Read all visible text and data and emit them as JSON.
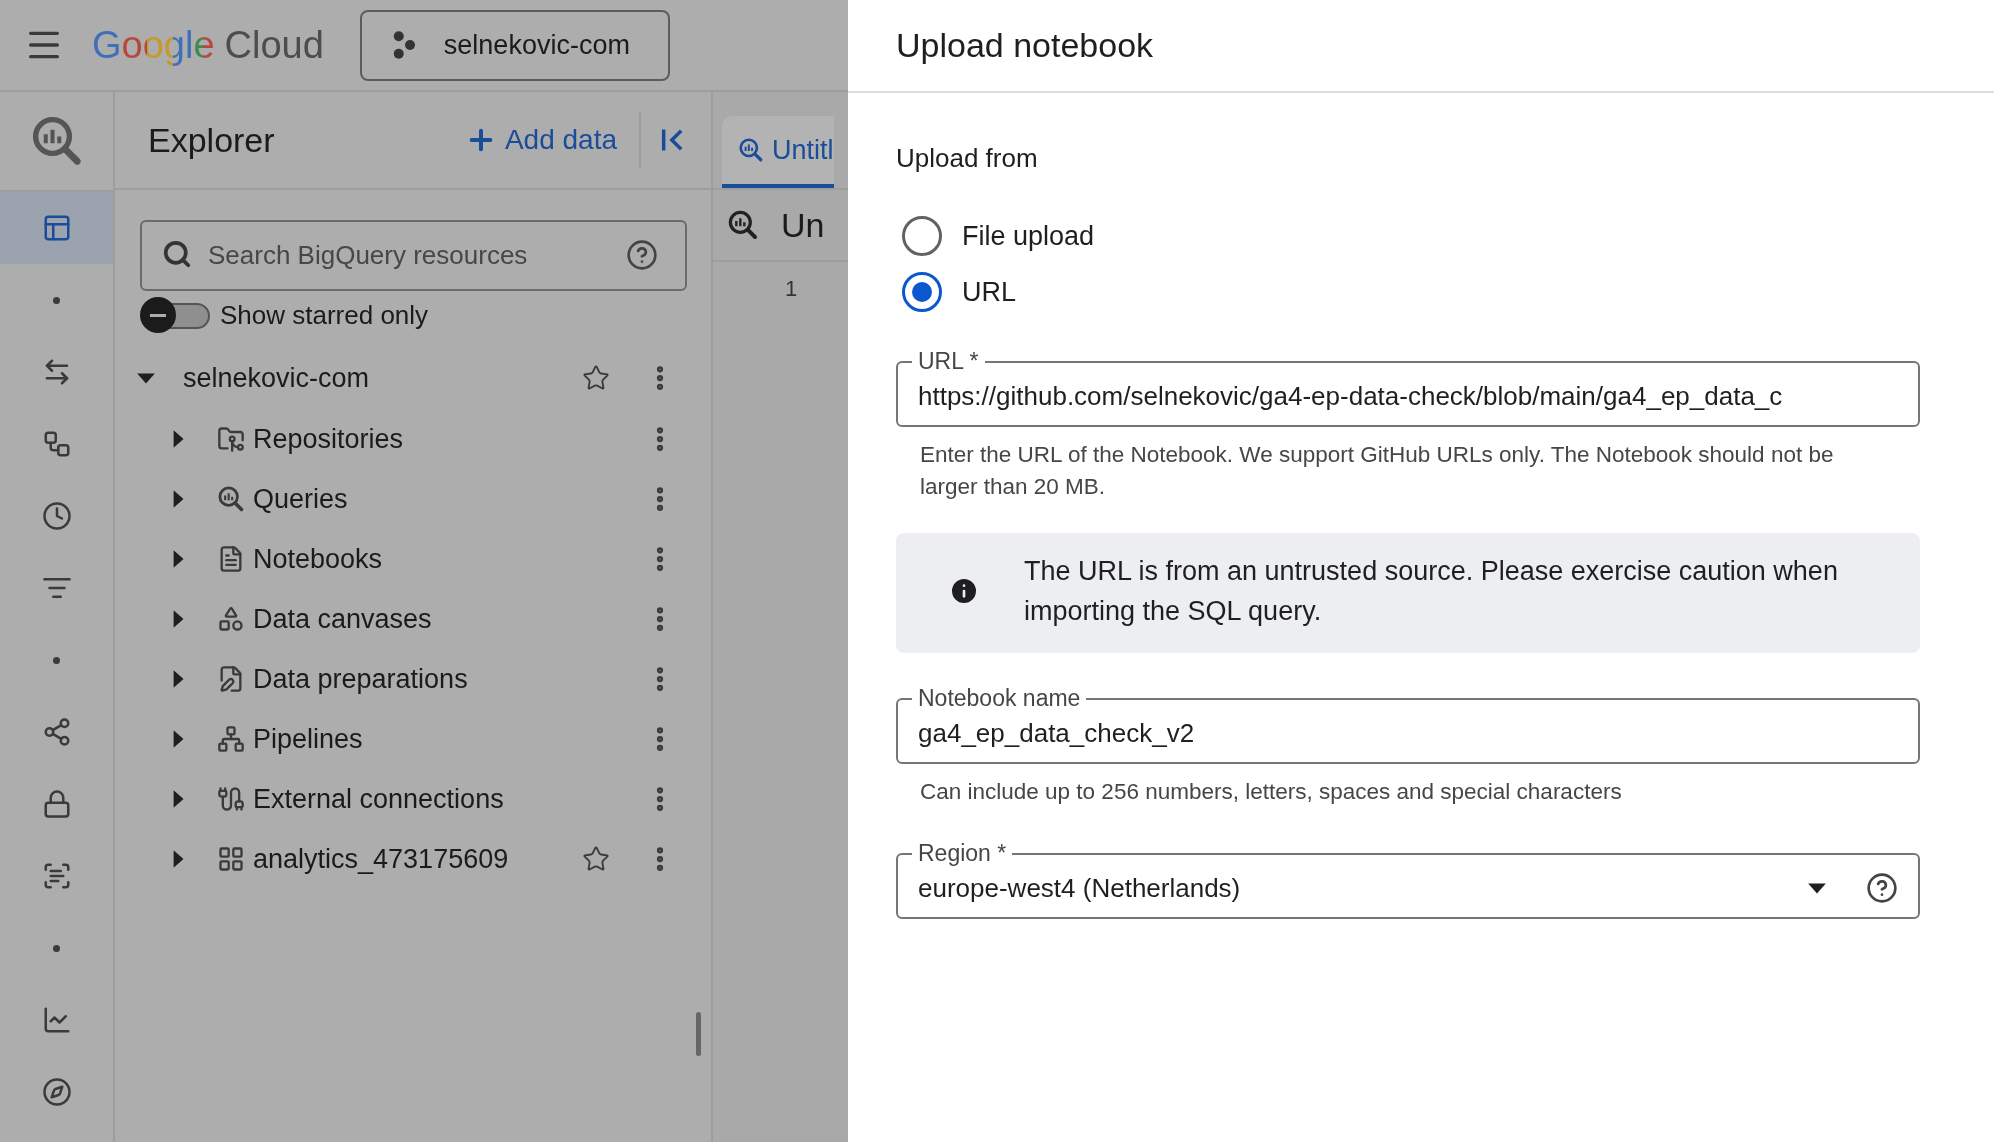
{
  "topbar": {
    "logo_google": "Google",
    "logo_product": "Cloud",
    "project": "selnekovic-com"
  },
  "rail": {
    "items": [
      {
        "kind": "explorer",
        "selected": true
      },
      {
        "kind": "dot",
        "selected": false
      },
      {
        "kind": "transfers",
        "selected": false
      },
      {
        "kind": "pipelines",
        "selected": false
      },
      {
        "kind": "history",
        "selected": false
      },
      {
        "kind": "filter",
        "selected": false
      },
      {
        "kind": "dot",
        "selected": false
      },
      {
        "kind": "sharing",
        "selected": false
      },
      {
        "kind": "lock",
        "selected": false
      },
      {
        "kind": "scan",
        "selected": false
      },
      {
        "kind": "dot",
        "selected": false
      },
      {
        "kind": "chart",
        "selected": false
      },
      {
        "kind": "compass",
        "selected": false
      }
    ]
  },
  "explorer": {
    "title": "Explorer",
    "add_data": "Add data",
    "search": {
      "placeholder": "Search BigQuery resources"
    },
    "starred_toggle": {
      "label": "Show starred only",
      "on": false
    },
    "tree": [
      {
        "label": "selnekovic-com",
        "kind": "project",
        "expanded": true,
        "children": [
          {
            "label": "Repositories",
            "kind": "repositories",
            "expanded": false
          },
          {
            "label": "Queries",
            "kind": "queries",
            "expanded": false
          },
          {
            "label": "Notebooks",
            "kind": "notebooks",
            "expanded": false
          },
          {
            "label": "Data canvases",
            "kind": "canvases",
            "expanded": false
          },
          {
            "label": "Data preparations",
            "kind": "preparations",
            "expanded": false
          },
          {
            "label": "Pipelines",
            "kind": "pipelines",
            "expanded": false
          },
          {
            "label": "External connections",
            "kind": "connections",
            "expanded": false
          },
          {
            "label": "analytics_473175609",
            "kind": "dataset",
            "expanded": false
          }
        ]
      }
    ]
  },
  "editor": {
    "tabs": [
      {
        "label": "Untitl",
        "selected": true
      }
    ],
    "title": "Un",
    "line_numbers": [
      "1"
    ]
  },
  "dialog": {
    "title": "Upload notebook",
    "upload_from": "Upload from",
    "sources": [
      {
        "label": "File upload",
        "selected": false
      },
      {
        "label": "URL",
        "selected": true
      }
    ],
    "url_field": {
      "label": "URL *",
      "value": "https://github.com/selnekovic/ga4-ep-data-check/blob/main/ga4_ep_data_c",
      "helper": "Enter the URL of the Notebook. We support GitHub URLs only. The Notebook should not be larger than 20 MB."
    },
    "notice": "The URL is from an untrusted source. Please exercise caution when importing the SQL query.",
    "name_field": {
      "label": "Notebook name",
      "value": "ga4_ep_data_check_v2",
      "helper": "Can include up to 256 numbers, letters, spaces and special characters"
    },
    "region_field": {
      "label": "Region *",
      "value": "europe-west4 (Netherlands)"
    }
  }
}
